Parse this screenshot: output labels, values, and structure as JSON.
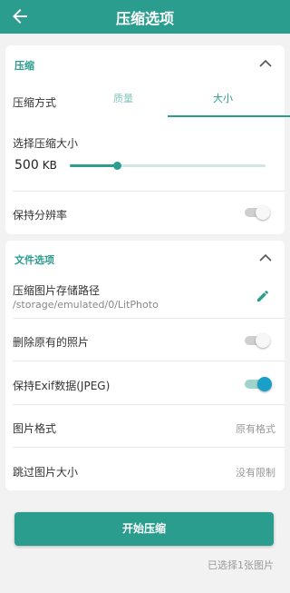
{
  "header": {
    "title": "压缩选项",
    "back_icon": "arrow-left-icon"
  },
  "compress_section": {
    "title": "压缩",
    "collapse_icon": "chevron-up-icon",
    "mode_label": "压缩方式",
    "tabs": [
      {
        "label": "质量",
        "selected": false
      },
      {
        "label": "大小",
        "selected": true
      }
    ],
    "size_label": "选择压缩大小",
    "size_value": "500",
    "size_unit": "KB",
    "size_slider_fraction": 0.24,
    "keep_resolution_label": "保持分辨率",
    "keep_resolution_on": false
  },
  "file_section": {
    "title": "文件选项",
    "collapse_icon": "chevron-up-icon",
    "save_path_label": "压缩图片存储路径",
    "save_path_value": "/storage/emulated/0/LitPhoto",
    "edit_icon": "pencil-icon",
    "delete_original_label": "删除原有的照片",
    "delete_original_on": false,
    "keep_exif_label": "保持Exif数据(JPEG)",
    "keep_exif_on": true,
    "format_label": "图片格式",
    "format_value": "原有格式",
    "skip_size_label": "跳过图片大小",
    "skip_size_value": "没有限制"
  },
  "footer": {
    "start_button": "开始压缩",
    "selected_count": "已选择1张图片"
  },
  "colors": {
    "accent": "#2a9d8f",
    "switch_on": "#1aa0c8",
    "background": "#f2f2f2"
  }
}
